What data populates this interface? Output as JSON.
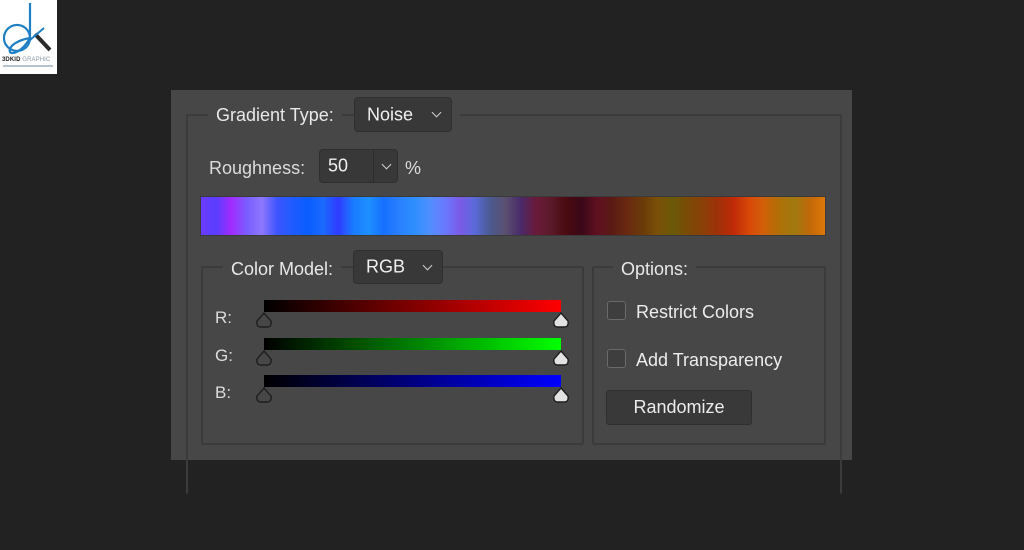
{
  "watermark": {
    "brand_bold": "3DKID",
    "brand_light": "GRAPHIC"
  },
  "dialog": {
    "gradient_type": {
      "label": "Gradient Type:",
      "value": "Noise"
    },
    "roughness": {
      "label": "Roughness:",
      "value": "50",
      "unit": "%"
    },
    "noise_preview": {
      "colors": [
        "#6a3cff",
        "#5a3dff",
        "#a22bff",
        "#7a5cff",
        "#8e78ff",
        "#3e55ff",
        "#1f5cff",
        "#0a5dff",
        "#1a6aff",
        "#2f3cff",
        "#1a7aff",
        "#1d90ff",
        "#1670ff",
        "#2a7fff",
        "#2d8fff",
        "#4f8fff",
        "#6a7aff",
        "#7a5ae8",
        "#5a6ad8",
        "#4a5a90",
        "#5a5070",
        "#4a2a6a",
        "#6a1a3a",
        "#5a1a2a",
        "#4a0a10",
        "#3a0818",
        "#601020",
        "#5a1a14",
        "#6a2a10",
        "#6a3a08",
        "#7a5008",
        "#6a5a08",
        "#7a4a06",
        "#8a4008",
        "#a03008",
        "#c02a08",
        "#d84808",
        "#d06008",
        "#b07008",
        "#a07a10",
        "#c06808",
        "#e07808"
      ]
    },
    "color_model": {
      "label": "Color Model:",
      "value": "RGB",
      "channels": [
        {
          "label": "R:",
          "end_color": "#ff0000",
          "min_stop": 0,
          "max_stop": 1
        },
        {
          "label": "G:",
          "end_color": "#00ff00",
          "min_stop": 0,
          "max_stop": 1
        },
        {
          "label": "B:",
          "end_color": "#0000ff",
          "min_stop": 0,
          "max_stop": 1
        }
      ]
    },
    "options": {
      "label": "Options:",
      "restrict_colors": {
        "label": "Restrict Colors",
        "checked": false
      },
      "add_transparency": {
        "label": "Add Transparency",
        "checked": false
      },
      "randomize_label": "Randomize"
    }
  }
}
